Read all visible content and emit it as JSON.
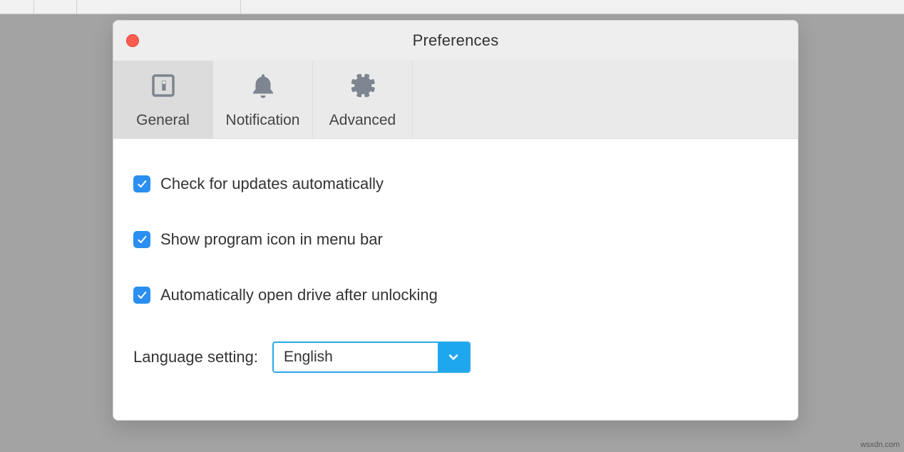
{
  "window": {
    "title": "Preferences"
  },
  "tabs": {
    "general": "General",
    "notification": "Notification",
    "advanced": "Advanced",
    "active": "general"
  },
  "general": {
    "check_updates": {
      "label": "Check for updates automatically",
      "checked": true
    },
    "show_menubar_icon": {
      "label": "Show program icon in menu bar",
      "checked": true
    },
    "auto_open_drive": {
      "label": "Automatically open drive after unlocking",
      "checked": true
    },
    "language_label": "Language setting:",
    "language_value": "English"
  },
  "watermark": "wsxdn.com"
}
